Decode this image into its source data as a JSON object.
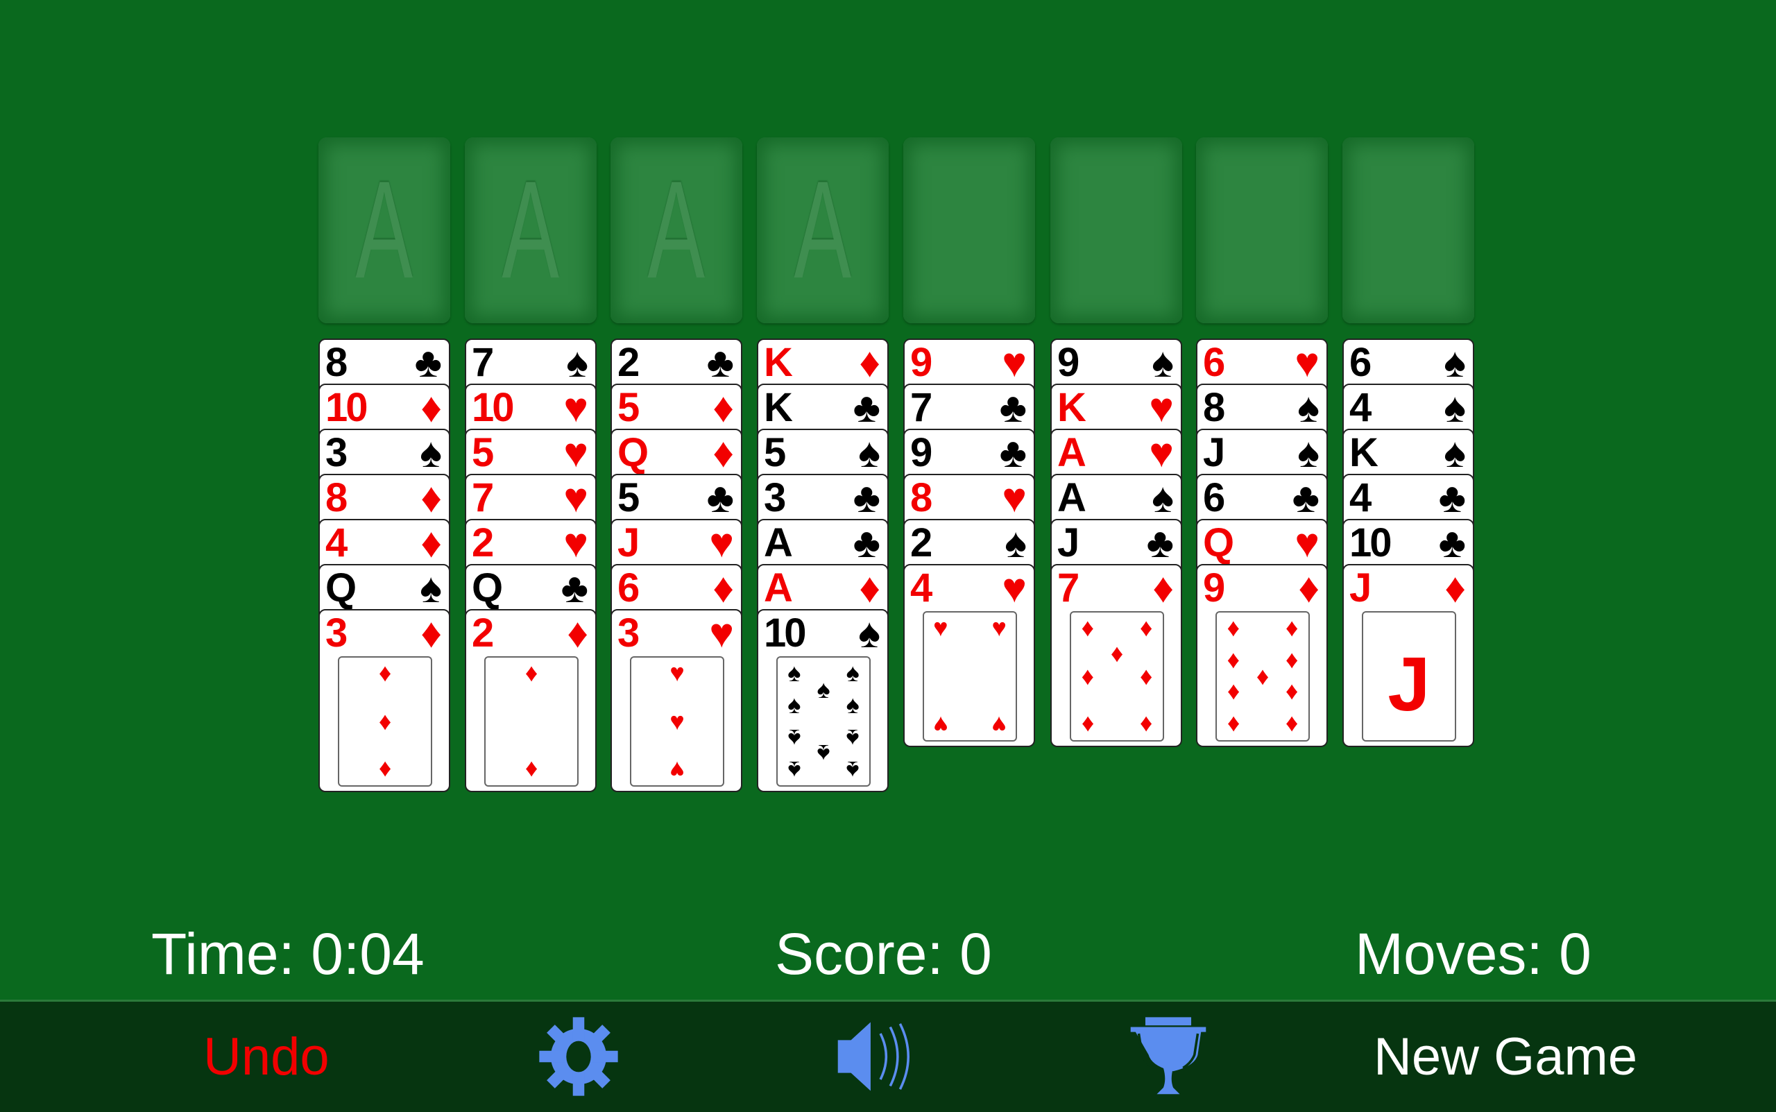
{
  "foundations": [
    {
      "label": "A"
    },
    {
      "label": "A"
    },
    {
      "label": "A"
    },
    {
      "label": "A"
    }
  ],
  "freecells": [
    {},
    {},
    {},
    {}
  ],
  "tableau": [
    [
      [
        "8",
        "♣"
      ],
      [
        "10",
        "♦"
      ],
      [
        "3",
        "♠"
      ],
      [
        "8",
        "♦"
      ],
      [
        "4",
        "♦"
      ],
      [
        "Q",
        "♠"
      ],
      [
        "3",
        "♦"
      ]
    ],
    [
      [
        "7",
        "♠"
      ],
      [
        "10",
        "♥"
      ],
      [
        "5",
        "♥"
      ],
      [
        "7",
        "♥"
      ],
      [
        "2",
        "♥"
      ],
      [
        "Q",
        "♣"
      ],
      [
        "2",
        "♦"
      ]
    ],
    [
      [
        "2",
        "♣"
      ],
      [
        "5",
        "♦"
      ],
      [
        "Q",
        "♦"
      ],
      [
        "5",
        "♣"
      ],
      [
        "J",
        "♥"
      ],
      [
        "6",
        "♦"
      ],
      [
        "3",
        "♥"
      ]
    ],
    [
      [
        "K",
        "♦"
      ],
      [
        "K",
        "♣"
      ],
      [
        "5",
        "♠"
      ],
      [
        "3",
        "♣"
      ],
      [
        "A",
        "♣"
      ],
      [
        "A",
        "♦"
      ],
      [
        "10",
        "♠"
      ]
    ],
    [
      [
        "9",
        "♥"
      ],
      [
        "7",
        "♣"
      ],
      [
        "9",
        "♣"
      ],
      [
        "8",
        "♥"
      ],
      [
        "2",
        "♠"
      ],
      [
        "4",
        "♥"
      ]
    ],
    [
      [
        "9",
        "♠"
      ],
      [
        "K",
        "♥"
      ],
      [
        "A",
        "♥"
      ],
      [
        "A",
        "♠"
      ],
      [
        "J",
        "♣"
      ],
      [
        "7",
        "♦"
      ]
    ],
    [
      [
        "6",
        "♥"
      ],
      [
        "8",
        "♠"
      ],
      [
        "J",
        "♠"
      ],
      [
        "6",
        "♣"
      ],
      [
        "Q",
        "♥"
      ],
      [
        "9",
        "♦"
      ]
    ],
    [
      [
        "6",
        "♠"
      ],
      [
        "4",
        "♠"
      ],
      [
        "K",
        "♠"
      ],
      [
        "4",
        "♣"
      ],
      [
        "10",
        "♣"
      ],
      [
        "J",
        "♦"
      ]
    ]
  ],
  "status": {
    "time": "Time: 0:04",
    "score": "Score: 0",
    "moves": "Moves: 0"
  },
  "toolbar": {
    "undo": "Undo",
    "new_game": "New Game",
    "icons": [
      "gear-icon",
      "speaker-icon",
      "trophy-icon"
    ]
  },
  "colors": {
    "felt": "#0a691e",
    "bar": "#063510",
    "red": "#f20000",
    "icon": "#5b8def"
  }
}
